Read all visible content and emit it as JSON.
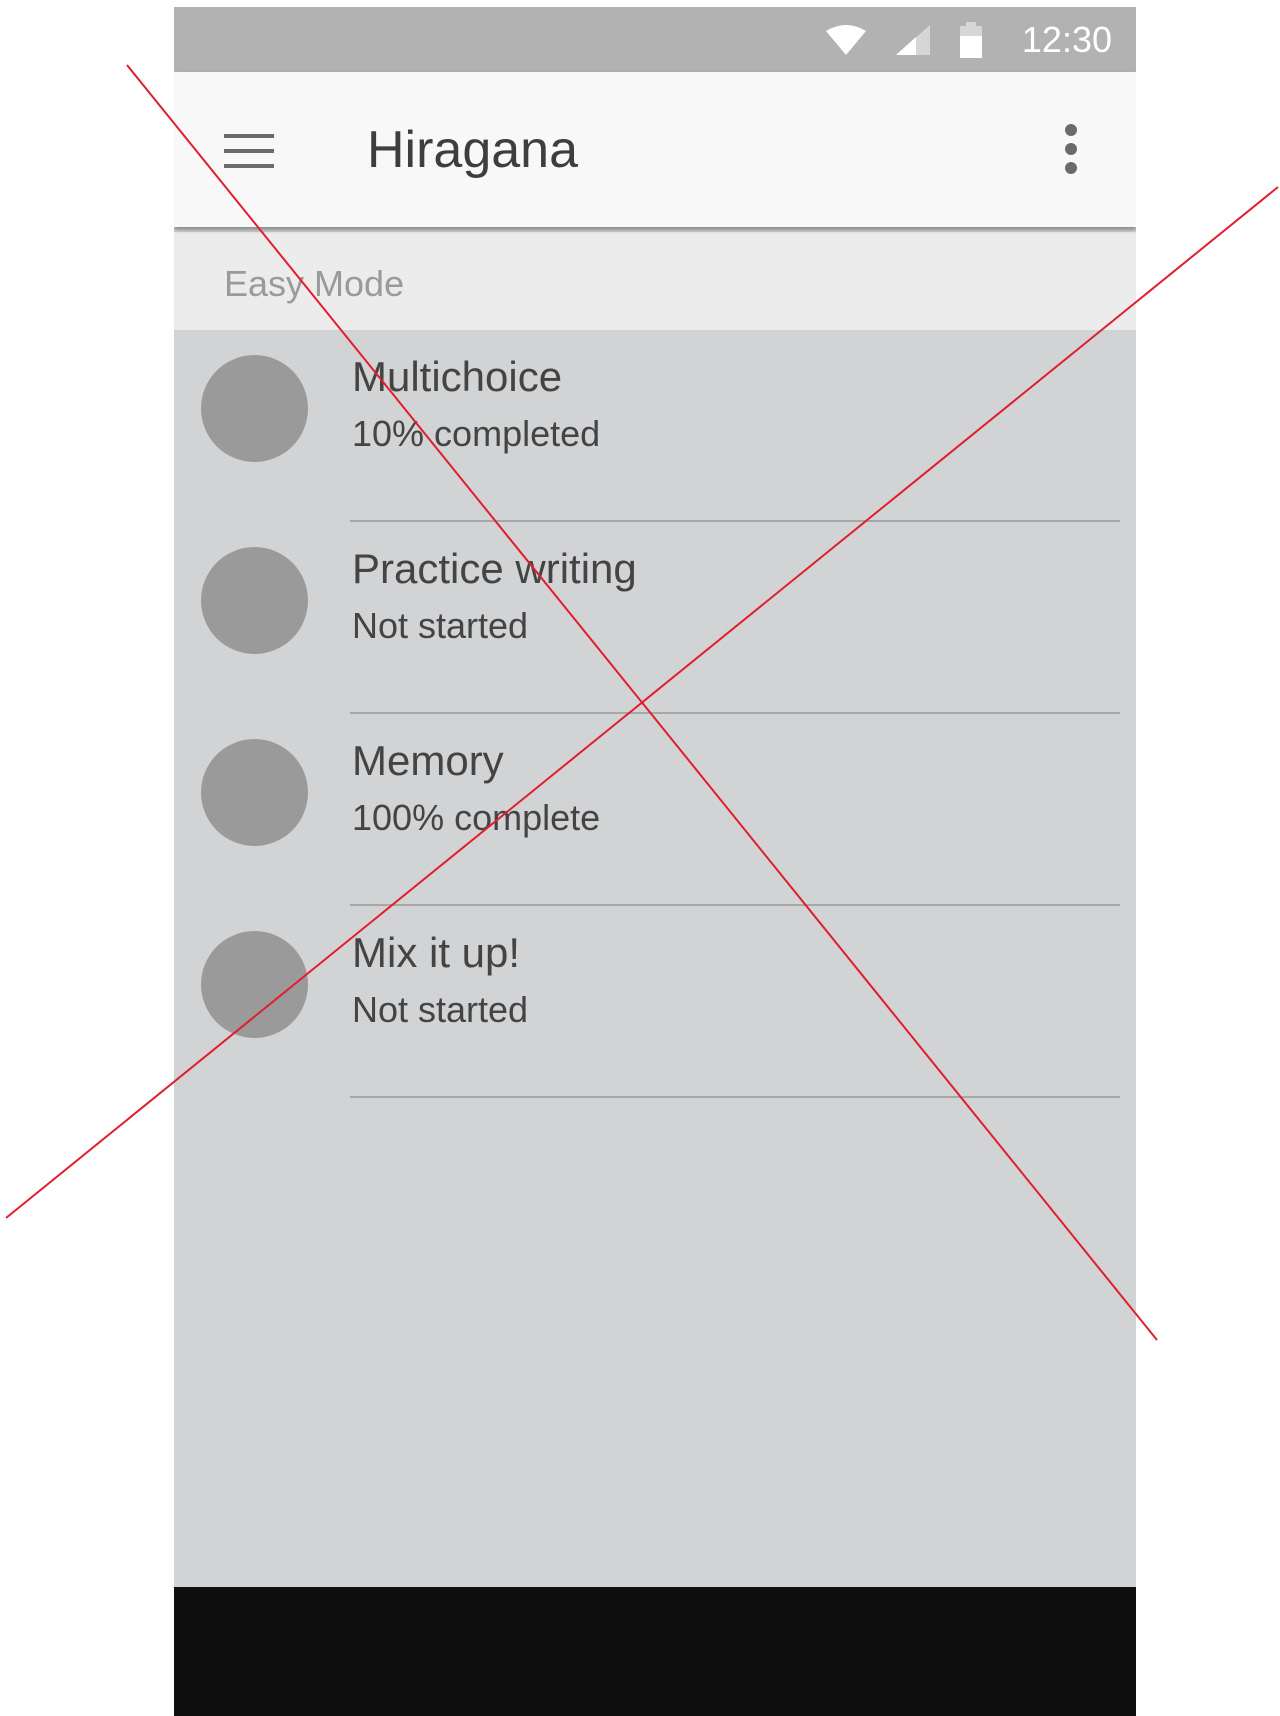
{
  "status_bar": {
    "time": "12:30",
    "icons": [
      "wifi-icon",
      "signal-icon",
      "battery-icon"
    ]
  },
  "app_bar": {
    "title": "Hiragana",
    "left_icon": "menu-icon",
    "right_icon": "overflow-menu-icon"
  },
  "section": {
    "label": "Easy Mode"
  },
  "list": {
    "items": [
      {
        "title": "Multichoice",
        "subtitle": "10% completed"
      },
      {
        "title": "Practice writing",
        "subtitle": "Not started"
      },
      {
        "title": "Memory",
        "subtitle": "100% complete"
      },
      {
        "title": "Mix it up!",
        "subtitle": "Not started"
      }
    ]
  },
  "colors": {
    "status_bar": "#b2b2b2",
    "app_bar": "#f8f8f8",
    "section_header": "#ececec",
    "list_background": "#d2d3d5",
    "avatar": "#9a9a9a",
    "nav_bar": "#0f0f0f",
    "cross_lines": "#e01e2d"
  }
}
